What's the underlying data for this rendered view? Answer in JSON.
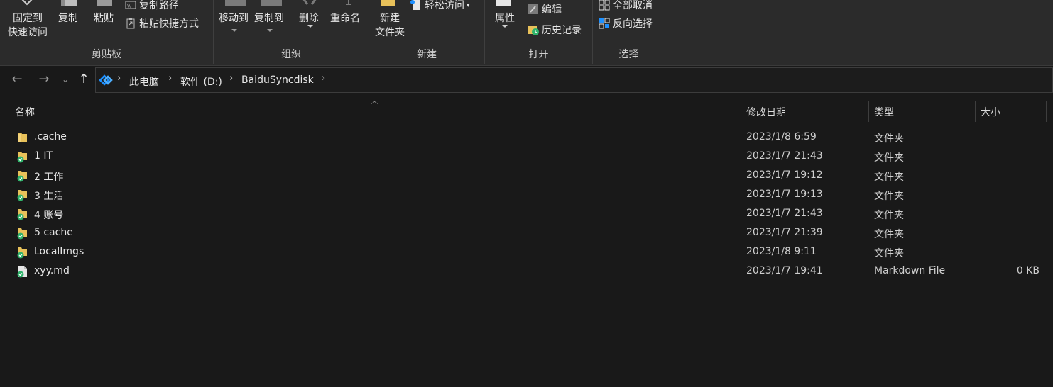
{
  "ribbon": {
    "clipboard": {
      "pin_label_1": "固定到",
      "pin_label_2": "快速访问",
      "copy_label": "复制",
      "paste_label": "粘贴",
      "copy_path_label": "复制路径",
      "paste_shortcut_label": "粘贴快捷方式",
      "group_label": "剪贴板"
    },
    "organize": {
      "move_to_label": "移动到",
      "copy_to_label": "复制到",
      "delete_label": "删除",
      "rename_label": "重命名",
      "group_label": "组织"
    },
    "new": {
      "new_folder_label_1": "新建",
      "new_folder_label_2": "文件夹",
      "easy_access_label": "轻松访问",
      "group_label": "新建"
    },
    "open": {
      "properties_label": "属性",
      "edit_label": "编辑",
      "history_label": "历史记录",
      "group_label": "打开"
    },
    "select": {
      "select_none_label": "全部取消",
      "invert_selection_label": "反向选择",
      "group_label": "选择"
    }
  },
  "address_bar": {
    "crumbs": [
      "此电脑",
      "软件 (D:)",
      "BaiduSyncdisk"
    ]
  },
  "columns": {
    "name": "名称",
    "date": "修改日期",
    "type": "类型",
    "size": "大小"
  },
  "files": [
    {
      "name": ".cache",
      "date": "2023/1/8 6:59",
      "type": "文件夹",
      "size": "",
      "icon": "folder-icon",
      "synced": false
    },
    {
      "name": "1 IT",
      "date": "2023/1/7 21:43",
      "type": "文件夹",
      "size": "",
      "icon": "folder-synced-icon",
      "synced": true
    },
    {
      "name": "2 工作",
      "date": "2023/1/7 19:12",
      "type": "文件夹",
      "size": "",
      "icon": "folder-synced-icon",
      "synced": true
    },
    {
      "name": "3 生活",
      "date": "2023/1/7 19:13",
      "type": "文件夹",
      "size": "",
      "icon": "folder-synced-icon",
      "synced": true
    },
    {
      "name": "4 账号",
      "date": "2023/1/7 21:43",
      "type": "文件夹",
      "size": "",
      "icon": "folder-synced-icon",
      "synced": true
    },
    {
      "name": "5 cache",
      "date": "2023/1/7 21:39",
      "type": "文件夹",
      "size": "",
      "icon": "folder-synced-icon",
      "synced": true
    },
    {
      "name": "LocalImgs",
      "date": "2023/1/8 9:11",
      "type": "文件夹",
      "size": "",
      "icon": "folder-synced-icon",
      "synced": true
    },
    {
      "name": "xyy.md",
      "date": "2023/1/7 19:41",
      "type": "Markdown File",
      "size": "0 KB",
      "icon": "file-synced-icon",
      "synced": true
    }
  ],
  "colors": {
    "background": "#191919",
    "ribbon": "#2b2b2b",
    "folder": "#e8c15a",
    "sync_check": "#2fb36b",
    "accent": "#1e90ff"
  }
}
